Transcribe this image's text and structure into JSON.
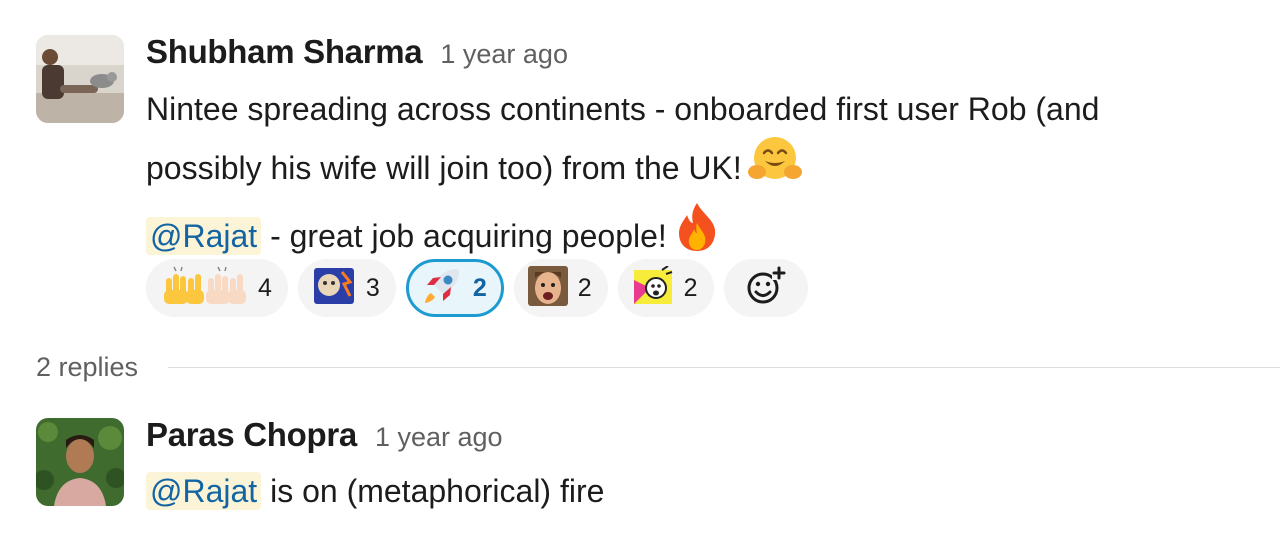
{
  "message": {
    "author": "Shubham Sharma",
    "timestamp": "1 year ago",
    "lines": {
      "line1": "Nintee spreading across continents - onboarded first user Rob (and",
      "line2": "possibly his wife will join too) from the UK!",
      "line3_mention": "@Rajat",
      "line3_rest": " - great job acquiring people!"
    },
    "emojis": [
      "hugging-face-icon",
      "fire-icon"
    ],
    "reactions": [
      {
        "icon": "raised-hands-icon",
        "count": "4",
        "active": false
      },
      {
        "icon": "meme-brain-icon",
        "count": "3",
        "active": false
      },
      {
        "icon": "rocket-icon",
        "count": "2",
        "active": true
      },
      {
        "icon": "shocked-face-icon",
        "count": "2",
        "active": false
      },
      {
        "icon": "mind-blown-icon",
        "count": "2",
        "active": false
      }
    ],
    "add_reaction_icon": "add-reaction-icon"
  },
  "thread": {
    "replies_label": "2 replies"
  },
  "reply": {
    "author": "Paras Chopra",
    "timestamp": "1 year ago",
    "mention": "@Rajat",
    "text": " is on (metaphorical) fire"
  },
  "colors": {
    "mention_bg": "#fcf4d7",
    "mention_text": "#1264a3",
    "active_reaction_border": "#1d9bd1",
    "active_reaction_bg": "#e8f5fa"
  }
}
